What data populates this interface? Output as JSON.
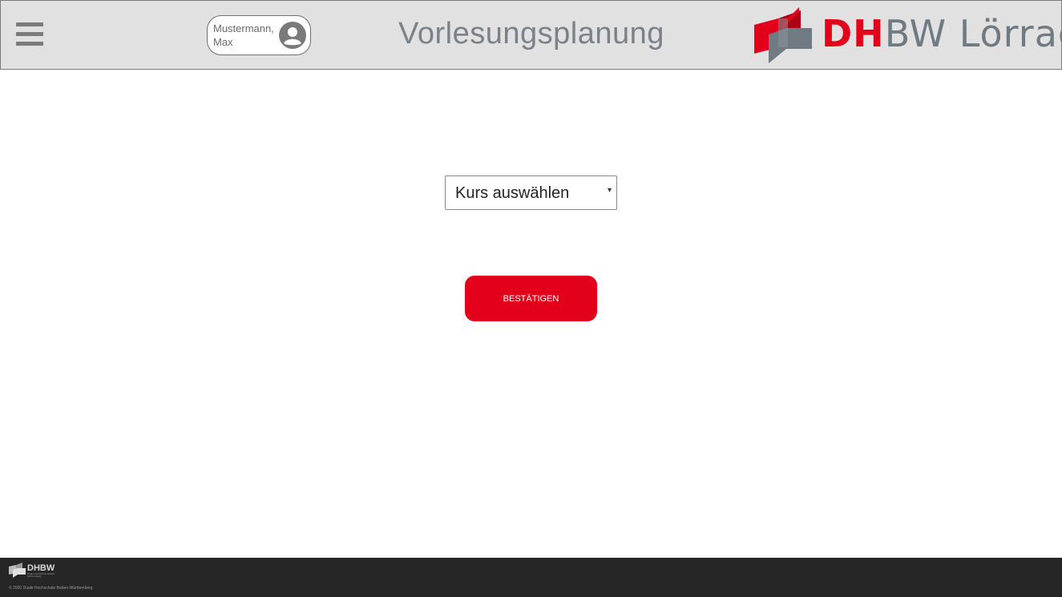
{
  "header": {
    "user": {
      "name": "Mustermann, Max"
    },
    "title": "Vorlesungsplanung",
    "brand": {
      "part1": "DH",
      "part2": "BW Lörrach"
    }
  },
  "main": {
    "course_select": {
      "value": "Kurs auswählen"
    },
    "confirm_label": "BESTÄTIGEN"
  },
  "footer": {
    "brand": "DHBW",
    "brand_sub": "Duale Hochschule Baden-Württemberg",
    "copyright": "© 2020 Duale Hochschule Baden-Württemberg"
  },
  "colors": {
    "accent": "#e2001a",
    "header_bg": "#e1e1e1",
    "footer_bg": "#262626"
  }
}
